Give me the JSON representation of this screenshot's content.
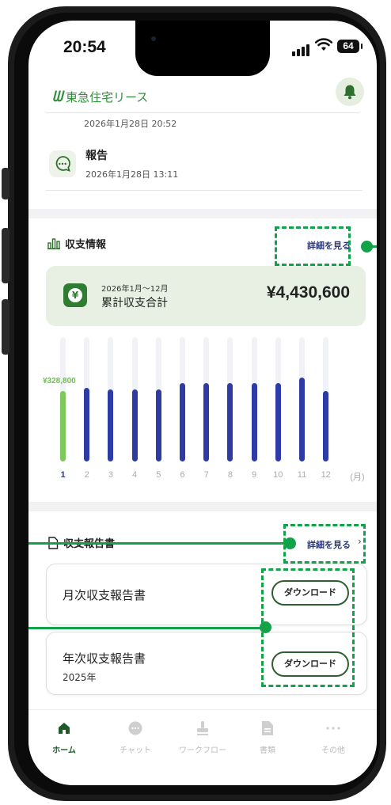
{
  "status_bar": {
    "time": "20:54",
    "battery": "64"
  },
  "header": {
    "logo_mark": "ᗯ",
    "logo_text": "東急住宅リース"
  },
  "notifications": {
    "partial_date": "2026年1月28日 20:52",
    "items": [
      {
        "title": "報告",
        "date": "2026年1月28日 13:11"
      }
    ]
  },
  "income": {
    "title": "収支情報",
    "detail_label": "詳細を見る",
    "summary": {
      "period": "2026年1月〜12月",
      "label": "累計収支合計",
      "amount": "¥4,430,600"
    }
  },
  "chart_data": {
    "type": "bar",
    "categories": [
      "1",
      "2",
      "3",
      "4",
      "5",
      "6",
      "7",
      "8",
      "9",
      "10",
      "11",
      "12"
    ],
    "unit_label": "(月)",
    "values": [
      328800,
      345000,
      338000,
      338000,
      338000,
      364000,
      364000,
      364000,
      364000,
      364000,
      392000,
      330000
    ],
    "data_labels": [
      {
        "index": 0,
        "text": "¥328,800"
      }
    ],
    "highlight_index": 0,
    "ylim": [
      0,
      580000
    ],
    "colors": {
      "highlight": "#7dc95e",
      "default": "#2e3aa6",
      "track": "#f1f2f6"
    },
    "grid": false
  },
  "reports": {
    "title": "収支報告書",
    "detail_label": "詳細を見る",
    "items": [
      {
        "name": "月次収支報告書",
        "sub": "",
        "button": "ダウンロード"
      },
      {
        "name": "年次収支報告書",
        "sub": "2025年",
        "button": "ダウンロード"
      }
    ]
  },
  "tabs": [
    {
      "label": "ホーム",
      "icon": "home-icon",
      "active": true
    },
    {
      "label": "チャット",
      "icon": "chat-icon",
      "active": false
    },
    {
      "label": "ワークフロー",
      "icon": "stamp-icon",
      "active": false
    },
    {
      "label": "書類",
      "icon": "document-icon",
      "active": false
    },
    {
      "label": "その他",
      "icon": "more-icon",
      "active": false
    }
  ],
  "colors": {
    "brand_green": "#2f8f3b",
    "annotation_green": "#12a34a",
    "navy": "#2c3a7a"
  }
}
